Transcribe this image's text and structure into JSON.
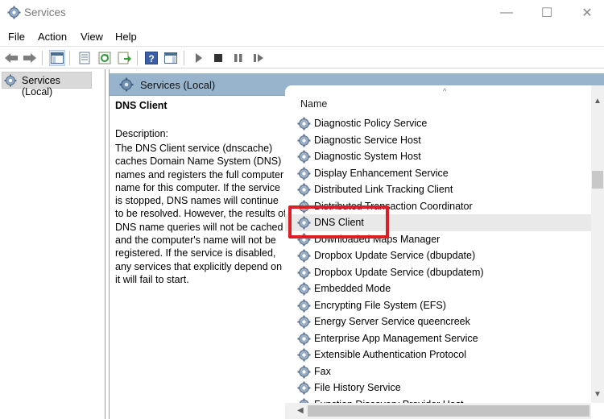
{
  "window": {
    "title": "Services",
    "controls": {
      "minimize": "—",
      "maximize": "☐",
      "close": "✕"
    }
  },
  "menu": [
    "File",
    "Action",
    "View",
    "Help"
  ],
  "toolbar": {
    "buttons": [
      "back-icon",
      "forward-icon",
      "show-hide-console-tree-icon",
      "properties-icon",
      "refresh-icon",
      "export-list-icon",
      "help-icon",
      "show-hide-action-pane-icon",
      "start-service-icon",
      "stop-service-icon",
      "pause-service-icon",
      "restart-service-icon"
    ]
  },
  "tree": {
    "root": "Services (Local)"
  },
  "pane": {
    "header": "Services (Local)",
    "selected_service": "DNS Client",
    "description_label": "Description:",
    "description": "The DNS Client service (dnscache) caches Domain Name System (DNS) names and registers the full computer name for this computer. If the service is stopped, DNS names will continue to be resolved. However, the results of DNS name queries will not be cached and the computer's name will not be registered. If the service is disabled, any services that explicitly depend on it will fail to start."
  },
  "list": {
    "column_name": "Name",
    "sort_indicator": "^",
    "rows": [
      "Diagnostic Policy Service",
      "Diagnostic Service Host",
      "Diagnostic System Host",
      "Display Enhancement Service",
      "Distributed Link Tracking Client",
      "Distributed Transaction Coordinator",
      "DNS Client",
      "Downloaded Maps Manager",
      "Dropbox Update Service (dbupdate)",
      "Dropbox Update Service (dbupdatem)",
      "Embedded Mode",
      "Encrypting File System (EFS)",
      "Energy Server Service queencreek",
      "Enterprise App Management Service",
      "Extensible Authentication Protocol",
      "Fax",
      "File History Service",
      "Function Discovery Provider Host"
    ],
    "selected_index": 6
  },
  "colors": {
    "pane_header": "#98b4cc",
    "highlight": "#d92026",
    "selected_row": "#e9e9e9"
  }
}
